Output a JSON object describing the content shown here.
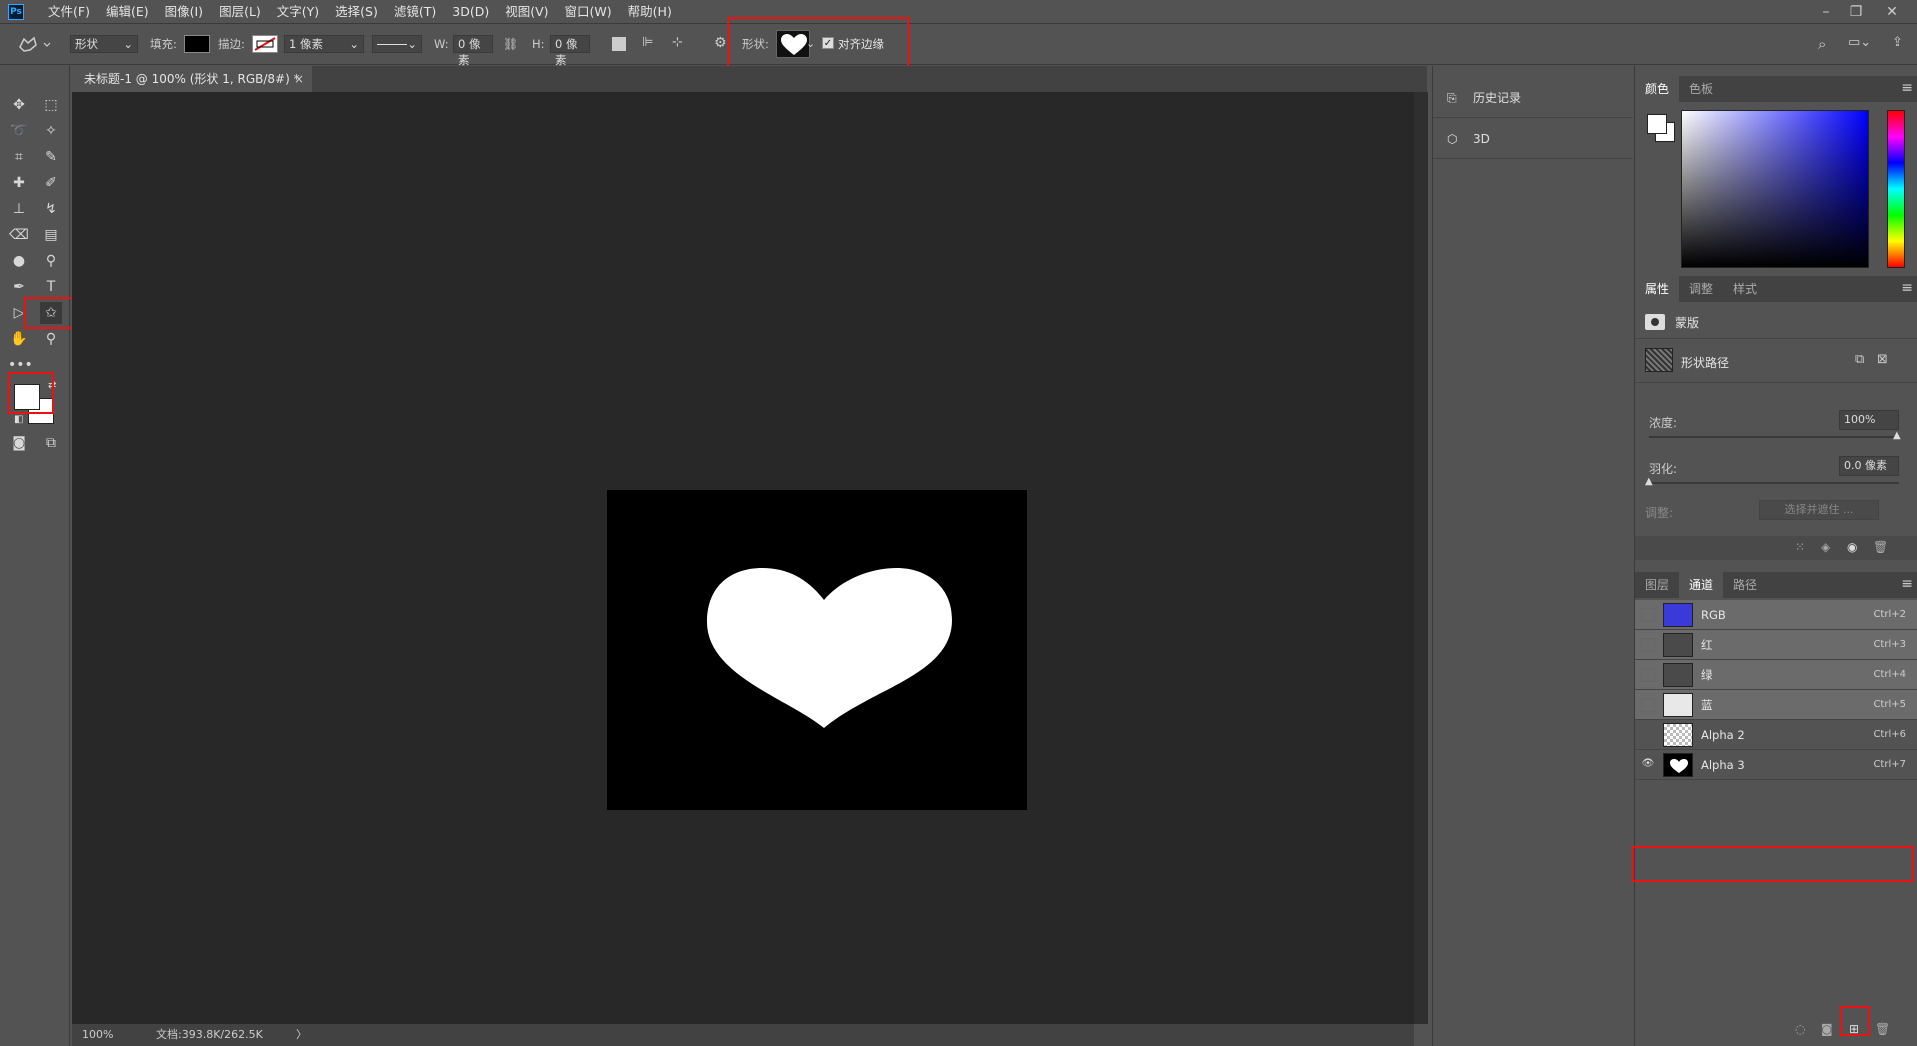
{
  "menu": {
    "logo": "Ps",
    "items": [
      "文件(F)",
      "编辑(E)",
      "图像(I)",
      "图层(L)",
      "文字(Y)",
      "选择(S)",
      "滤镜(T)",
      "3D(D)",
      "视图(V)",
      "窗口(W)",
      "帮助(H)"
    ]
  },
  "options": {
    "mode": "形状",
    "fill_label": "填充:",
    "stroke_label": "描边:",
    "stroke_width": "1 像素",
    "w_label": "W:",
    "w_value": "0 像素",
    "h_label": "H:",
    "h_value": "0 像素",
    "shape_label": "形状:",
    "align_edges": "对齐边缘",
    "align_checked": true
  },
  "document": {
    "tab_title": "未标题-1 @ 100% (形状 1, RGB/8#) *",
    "zoom": "100%",
    "doc_size": "文档:393.8K/262.5K"
  },
  "midpanel": {
    "items": [
      {
        "label": "历史记录",
        "icon": "history-icon"
      },
      {
        "label": "3D",
        "icon": "cube-icon"
      }
    ]
  },
  "color_panel": {
    "tabs": [
      "颜色",
      "色板"
    ],
    "active": "颜色",
    "hue_color": "#0000ff"
  },
  "properties": {
    "tabs": [
      "属性",
      "调整",
      "样式"
    ],
    "active": "属性",
    "mask_label": "蒙版",
    "shape_path": "形状路径",
    "density_label": "浓度:",
    "density_value": "100%",
    "density_fraction": 1.0,
    "feather_label": "羽化:",
    "feather_value": "0.0 像素",
    "feather_fraction": 0.0,
    "adjust_label": "调整:",
    "select_mask_button": "选择并遮住 ..."
  },
  "channels": {
    "tabs": [
      "图层",
      "通道",
      "路径"
    ],
    "active": "通道",
    "rows": [
      {
        "name": "RGB",
        "key": "Ctrl+2",
        "thumb": "#3a3ad8",
        "visible": false,
        "selected": true
      },
      {
        "name": "红",
        "key": "Ctrl+3",
        "thumb": "#4a4a4a",
        "visible": false,
        "selected": true
      },
      {
        "name": "绿",
        "key": "Ctrl+4",
        "thumb": "#4a4a4a",
        "visible": false,
        "selected": true
      },
      {
        "name": "蓝",
        "key": "Ctrl+5",
        "thumb": "#e8e8e8",
        "visible": false,
        "selected": true
      },
      {
        "name": "Alpha 2",
        "key": "Ctrl+6",
        "thumb": "checker",
        "visible": false,
        "selected": false
      },
      {
        "name": "Alpha 3",
        "key": "Ctrl+7",
        "thumb": "heart",
        "visible": true,
        "selected": false
      }
    ]
  },
  "colors": {
    "highlight_red": "#e11111",
    "foreground": "#ffffff",
    "background": "#ffffff"
  }
}
